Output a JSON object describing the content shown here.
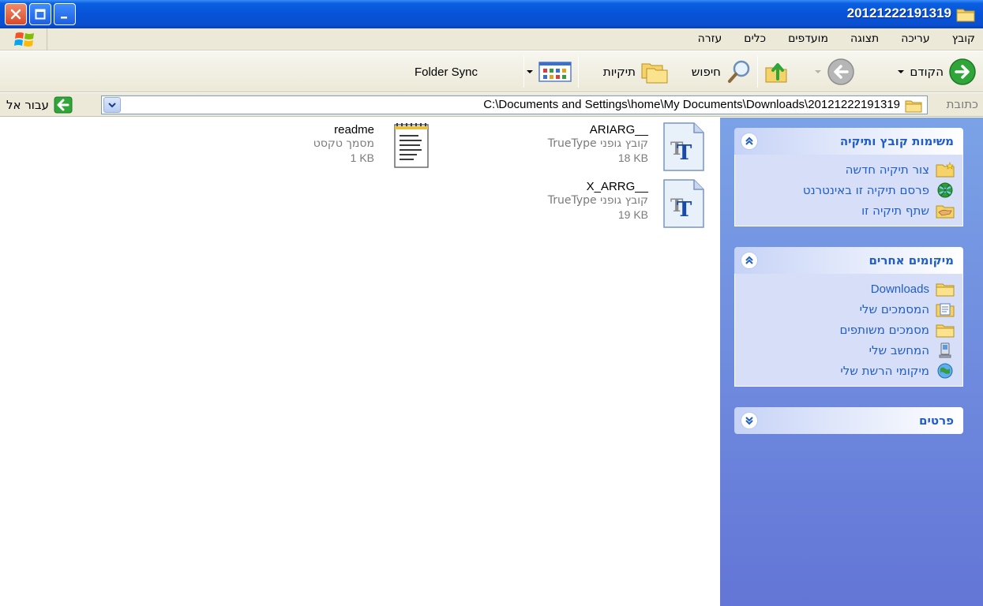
{
  "window": {
    "title": "20121222191319"
  },
  "menu": {
    "items": [
      "קובץ",
      "עריכה",
      "תצוגה",
      "מועדפים",
      "כלים",
      "עזרה"
    ]
  },
  "toolbar": {
    "back_label": "הקודם",
    "search_label": "חיפוש",
    "folders_label": "תיקיות",
    "folder_sync_label": "Folder Sync"
  },
  "address": {
    "label": "כתובת",
    "path": "C:\\Documents and Settings\\home\\My Documents\\Downloads\\20121222191319",
    "go_label": "עבור אל"
  },
  "taskpane": {
    "file_tasks": {
      "title": "משימות קובץ ותיקיה",
      "items": [
        {
          "label": "צור תיקיה חדשה",
          "icon": "new-folder-icon"
        },
        {
          "label": "פרסם תיקיה זו באינטרנט",
          "icon": "publish-web-icon"
        },
        {
          "label": "שתף תיקיה זו",
          "icon": "share-folder-icon"
        }
      ]
    },
    "other_places": {
      "title": "מיקומים אחרים",
      "items": [
        {
          "label": "Downloads",
          "icon": "folder-icon"
        },
        {
          "label": "המסמכים שלי",
          "icon": "my-documents-icon"
        },
        {
          "label": "מסמכים משותפים",
          "icon": "shared-folder-icon"
        },
        {
          "label": "המחשב שלי",
          "icon": "my-computer-icon"
        },
        {
          "label": "מיקומי הרשת שלי",
          "icon": "network-places-icon"
        }
      ]
    },
    "details": {
      "title": "פרטים"
    }
  },
  "files": [
    {
      "name": "ARIARG__",
      "type": "TrueType קובץ גופני",
      "size": "18 KB",
      "icon": "truetype-font-icon"
    },
    {
      "name": "readme",
      "type": "מסמך טקסט",
      "size": "1 KB",
      "icon": "text-document-icon"
    },
    {
      "name": "X_ARRG__",
      "type": "TrueType קובץ גופני",
      "size": "19 KB",
      "icon": "truetype-font-icon"
    }
  ],
  "colors": {
    "titlebar": "#0653d8",
    "taskpane_link": "#215dc6",
    "taskpane_bg": "#7ba2e7"
  }
}
